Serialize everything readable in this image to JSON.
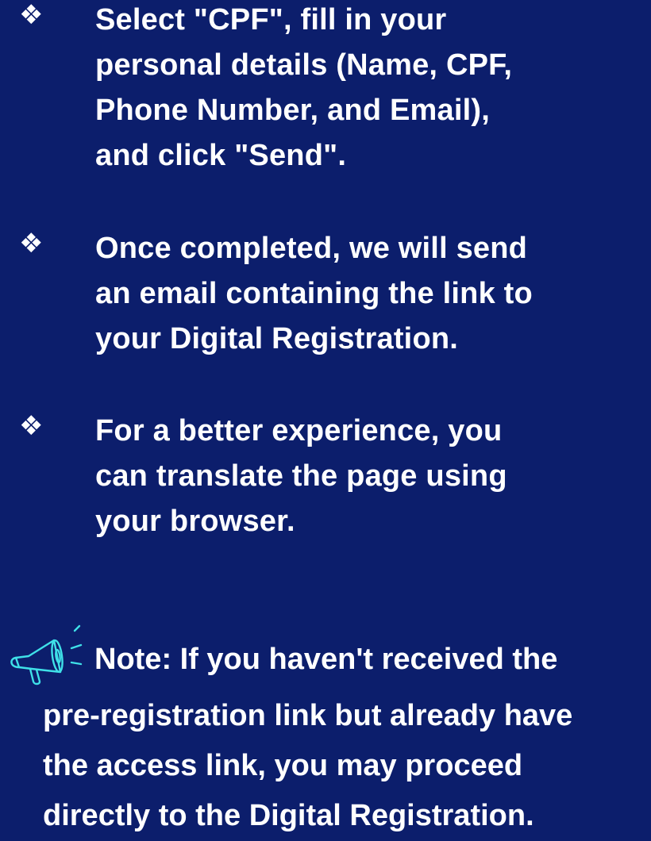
{
  "bullets": [
    {
      "glyph": "❖",
      "text": "Select \"CPF\", fill in your\npersonal details (Name, CPF,\nPhone Number, and Email),\nand click \"Send\"."
    },
    {
      "glyph": "❖",
      "text": "Once completed, we will send\nan email containing the link to\nyour Digital Registration."
    },
    {
      "glyph": "❖",
      "text": "For a better experience, you\ncan translate the page using\nyour browser."
    }
  ],
  "note": {
    "icon": "megaphone-icon",
    "first_line": "Note: If you haven't received the",
    "rest": "pre-registration link but already have\nthe access link, you may proceed\ndirectly to the Digital Registration."
  },
  "colors": {
    "background": "#0c1e6c",
    "text": "#ffffff",
    "icon_outline": "#3fe0e8"
  }
}
